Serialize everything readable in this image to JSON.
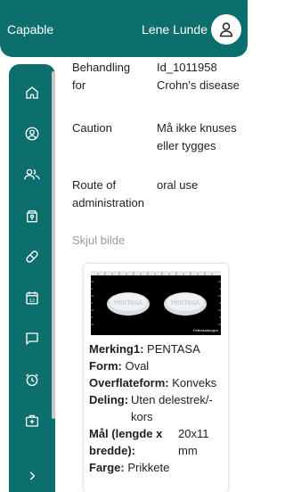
{
  "header": {
    "app_title": "Capable",
    "user_name": "Lene Lunde",
    "avatar_icon": "person-icon"
  },
  "sidebar": {
    "items": [
      {
        "icon": "home-icon"
      },
      {
        "icon": "profile-icon"
      },
      {
        "icon": "group-icon"
      },
      {
        "icon": "medicine-cabinet-icon"
      },
      {
        "icon": "pill-icon"
      },
      {
        "icon": "calendar-icon",
        "label": "12"
      },
      {
        "icon": "chat-icon"
      },
      {
        "icon": "alarm-icon"
      },
      {
        "icon": "first-aid-kit-icon"
      },
      {
        "icon": "chevron-right-icon"
      }
    ]
  },
  "details": {
    "treatment": {
      "label": "Behandling for",
      "value_line1": "Id_1011958",
      "value_line2": "Crohn's disease"
    },
    "caution": {
      "label": "Caution",
      "value_line1": "Må ikke knuses",
      "value_line2": "eller tygges"
    },
    "route": {
      "label_line1": "Route of",
      "label_line2": "administration",
      "value": "oral use"
    }
  },
  "hide_image_label": "Skjul bilde",
  "pill_card": {
    "photo_imprint": "PENTASA",
    "photo_caption": "Felleskatalogen",
    "marking": {
      "label": "Merking1:",
      "value": "PENTASA"
    },
    "form": {
      "label": "Form:",
      "value": "Oval"
    },
    "surface": {
      "label": "Overflateform:",
      "value": "Konveks"
    },
    "division": {
      "label": "Deling:",
      "value_line1": "Uten delestrek/-",
      "value_line2": "kors"
    },
    "size": {
      "label_line1": "Mål (lengde x",
      "label_line2": "bredde):",
      "value_line1": "20x11",
      "value_line2": "mm"
    },
    "color": {
      "label": "Farge:",
      "value": "Prikkete"
    }
  },
  "colors": {
    "primary": "#0d6e6e",
    "muted": "#9a9a9a"
  }
}
